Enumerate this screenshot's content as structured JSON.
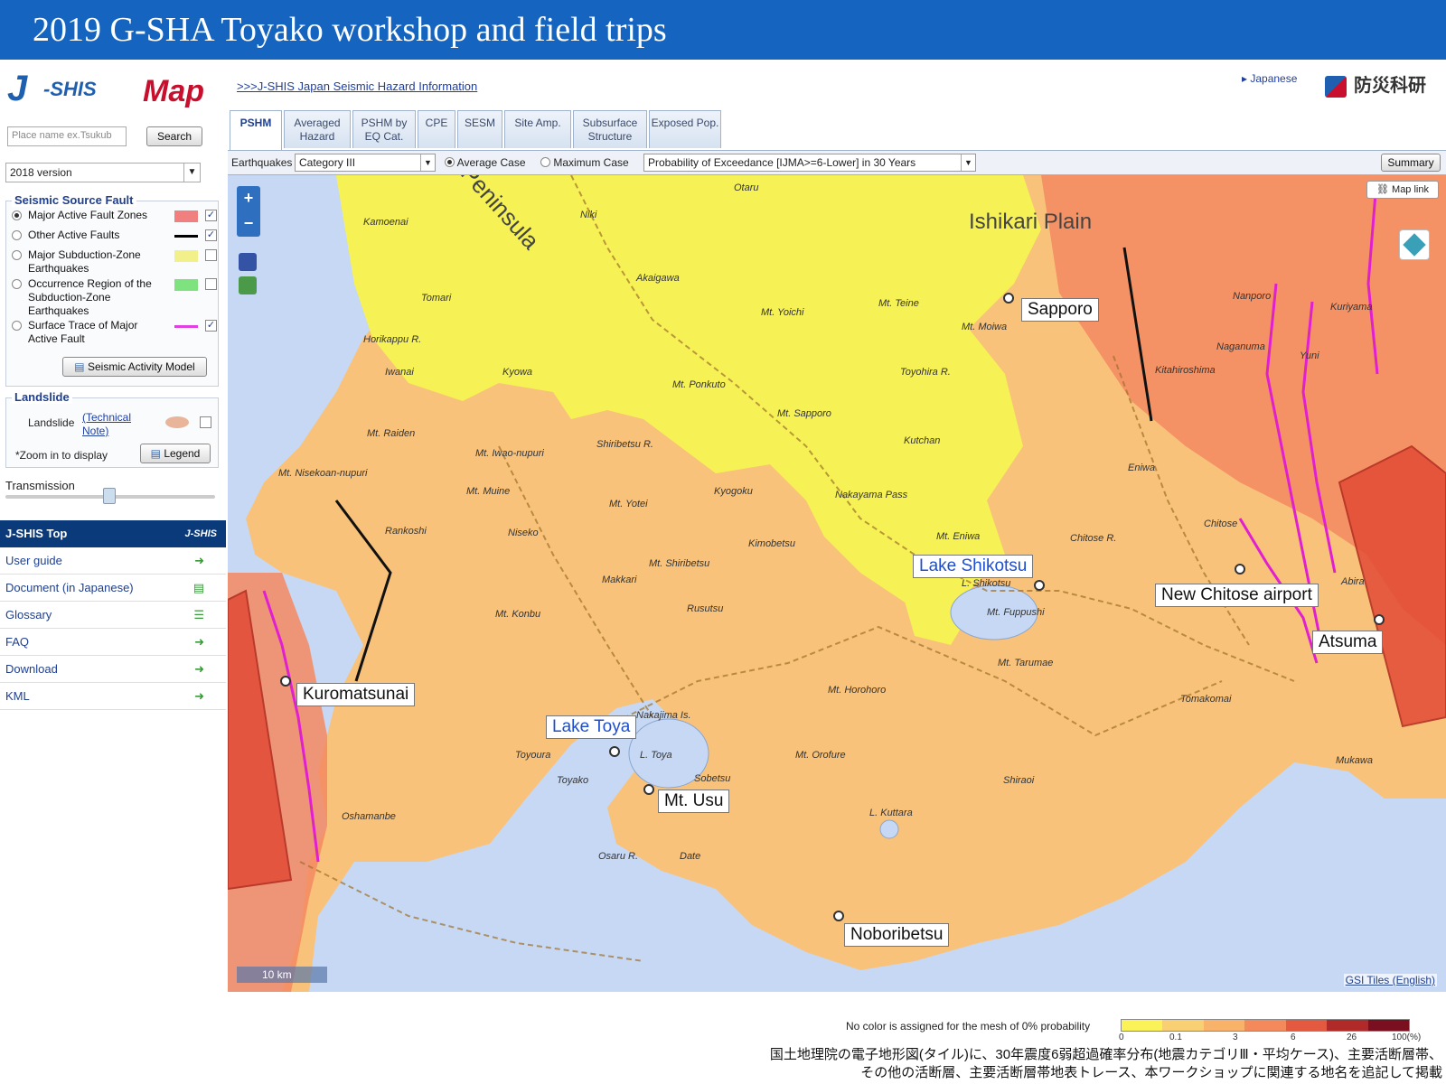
{
  "banner": {
    "title": "2019 G-SHA Toyako workshop and field trips"
  },
  "header": {
    "logo_j": "J",
    "logo_shis": "-SHIS",
    "logo_map": "Map",
    "link": ">>>J-SHIS Japan Seismic Hazard Information",
    "language": "▸ Japanese",
    "org": "防災科研"
  },
  "sidebar": {
    "search_placeholder": "Place name ex.Tsukub",
    "search_button": "Search",
    "version": "2018 version",
    "fault_group_title": "Seismic Source Fault",
    "faults": [
      {
        "label": "Major Active Fault Zones",
        "selected": true,
        "checked": true,
        "color": "#f08080"
      },
      {
        "label": "Other Active Faults",
        "selected": false,
        "checked": true,
        "color": "#000000"
      },
      {
        "label": "Major Subduction-Zone Earthquakes",
        "selected": false,
        "checked": false,
        "color": "#f1f08a"
      },
      {
        "label": "Occurrence Region of the Subduction-Zone Earthquakes",
        "selected": false,
        "checked": false,
        "color": "#7ee27e"
      },
      {
        "label": "Surface Trace of Major Active Fault",
        "selected": false,
        "checked": true,
        "color": "#e040e0"
      }
    ],
    "activity_button": "Seismic Activity Model",
    "landslide_title": "Landslide",
    "landslide_label": "Landslide",
    "landslide_note": "(Technical Note)",
    "landslide_color": "#e8b49a",
    "zoom_note": "*Zoom in to display",
    "legend_button": "Legend",
    "transmission": "Transmission",
    "top_title": "J-SHIS Top",
    "top_mini": "J-SHIS",
    "menu": [
      {
        "label": "User guide",
        "icon": "➜"
      },
      {
        "label": "Document (in Japanese)",
        "icon": "▤"
      },
      {
        "label": "Glossary",
        "icon": "☰"
      },
      {
        "label": "FAQ",
        "icon": "➜"
      },
      {
        "label": "Download",
        "icon": "➜"
      },
      {
        "label": "KML",
        "icon": "➜"
      }
    ]
  },
  "tabs": [
    {
      "label": "PSHM",
      "active": true
    },
    {
      "label": "Averaged Hazard",
      "active": false
    },
    {
      "label": "PSHM by EQ Cat.",
      "active": false
    },
    {
      "label": "CPE",
      "active": false
    },
    {
      "label": "SESM",
      "active": false
    },
    {
      "label": "Site Amp.",
      "active": false
    },
    {
      "label": "Subsurface Structure",
      "active": false
    },
    {
      "label": "Exposed Pop.",
      "active": false
    }
  ],
  "toolbar": {
    "earthquakes_label": "Earthquakes",
    "category": "Category III",
    "average_case": "Average Case",
    "maximum_case": "Maximum Case",
    "probability": "Probability of Exceedance [IJMA>=6-Lower] in 30 Years",
    "summary": "Summary"
  },
  "map": {
    "map_link": "Map link",
    "scale": "10 km",
    "gsi": "GSI Tiles (English)",
    "places": [
      "Ishikari Plain",
      "Peninsula",
      "Otaru",
      "Kamoenai",
      "Niki",
      "Tomari",
      "Akaigawa",
      "Mt. Yoichi",
      "Mt. Teine",
      "Horikappu R.",
      "Iwanai",
      "Kyowa",
      "Mt. Ponkuto",
      "Toyohira R.",
      "Mt. Raiden",
      "Mt. Iwao-nupuri",
      "Mt. Muine",
      "Mt. Sapporo",
      "Kutchan",
      "Shiribetsu R.",
      "Mt. Nisekoan-nupuri",
      "Mt. Yotei",
      "Kyogoku",
      "Nakayama Pass",
      "Rankoshi",
      "Niseko",
      "Kimobetsu",
      "Mt. Shiribetsu",
      "Makkari",
      "Mt. Konbu",
      "Rusutsu",
      "Mt. Eniwa",
      "L. Shikotsu",
      "Mt. Fuppushi",
      "Mt. Tarumae",
      "Chitose R.",
      "Chitose",
      "Eniwa",
      "Kitahiroshima",
      "Naganuma",
      "Yuni",
      "Kuriyama",
      "Nanporo",
      "Abira",
      "Tomakomai",
      "Mt. Horohoro",
      "Nakajima Is.",
      "L. Toya",
      "Toyoura",
      "Toyako",
      "Sobetsu",
      "Mt. Orofure",
      "Shiraoi",
      "Oshamanbe",
      "Date",
      "Osaru R.",
      "L. Kuttara",
      "Mukawa",
      "Mt. Moiwa",
      "Sapporo"
    ],
    "callouts": [
      {
        "label": "Sapporo",
        "blue": false
      },
      {
        "label": "Lake Shikotsu",
        "blue": true
      },
      {
        "label": "New Chitose airport",
        "blue": false
      },
      {
        "label": "Atsuma",
        "blue": false
      },
      {
        "label": "Kuromatsunai",
        "blue": false
      },
      {
        "label": "Lake Toya",
        "blue": true
      },
      {
        "label": "Mt. Usu",
        "blue": false
      },
      {
        "label": "Noboribetsu",
        "blue": false
      }
    ],
    "colors": {
      "sea": "#c6d8f3",
      "land": "#f9c27a",
      "yellow": "#f6f255",
      "high": "#f48a62",
      "fault_zone": "#e34b36",
      "trace": "#e020d0"
    }
  },
  "legend": {
    "caption": "No color is assigned for the mesh of 0% probability",
    "ticks": [
      "0",
      "0.1",
      "3",
      "6",
      "26",
      "100(%)"
    ],
    "colors": [
      "#fbf25a",
      "#f9cf74",
      "#f9b26a",
      "#f48a5c",
      "#e45a40",
      "#b12a2a",
      "#7a0f1f"
    ]
  },
  "footnote": {
    "line1": "国土地理院の電子地形図(タイル)に、30年震度6弱超過確率分布(地震カテゴリⅢ・平均ケース)、主要活断層帯、",
    "line2": "その他の活断層、主要活断層帯地表トレース、本ワークショップに関連する地名を追記して掲載"
  }
}
